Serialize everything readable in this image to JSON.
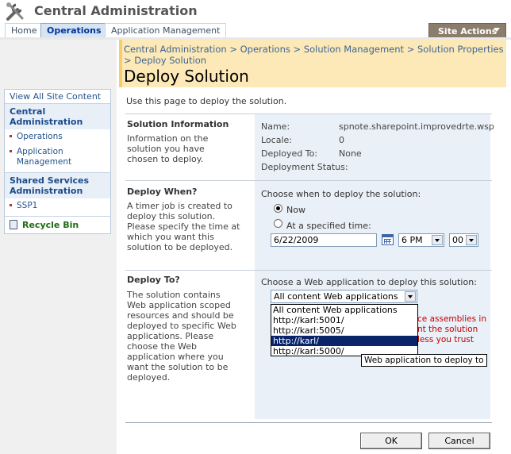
{
  "header": {
    "app_title": "Central Administration",
    "tabs": [
      "Home",
      "Operations",
      "Application Management"
    ],
    "selected_tab": "Operations",
    "site_actions": "Site Actions"
  },
  "leftnav": {
    "view_all": "View All Site Content",
    "groups": [
      {
        "title": "Central Administration",
        "items": [
          "Operations",
          "Application Management"
        ]
      },
      {
        "title": "Shared Services Administration",
        "items": [
          "SSP1"
        ]
      }
    ],
    "recycle_bin": "Recycle Bin"
  },
  "breadcrumb": "Central Administration > Operations > Solution Management > Solution Properties > Deploy Solution",
  "page_title": "Deploy Solution",
  "intro": "Use this page to deploy the solution.",
  "solution_info": {
    "title": "Solution Information",
    "description": "Information on the solution you have chosen to deploy.",
    "fields": [
      {
        "label": "Name:",
        "value": "spnote.sharepoint.improvedrte.wsp"
      },
      {
        "label": "Locale:",
        "value": "0"
      },
      {
        "label": "Deployed To:",
        "value": "None"
      },
      {
        "label": "Deployment Status:",
        "value": ""
      }
    ]
  },
  "deploy_when": {
    "title": "Deploy When?",
    "description": "A timer job is created to deploy this solution. Please specify the time at which you want this solution to be deployed.",
    "prompt": "Choose when to deploy the solution:",
    "option_now": "Now",
    "option_specified": "At a specified time:",
    "selected": "Now",
    "date": "6/22/2009",
    "hour": "6 PM",
    "minute": "00"
  },
  "deploy_to": {
    "title": "Deploy To?",
    "description": "The solution contains Web application scoped resources and should be deployed to specific Web applications. Please choose the Web application where you want the solution to be deployed.",
    "prompt": "Choose a Web application to deploy this solution:",
    "selected_value": "All content Web applications",
    "options": [
      "All content Web applications",
      "http://karl:5001/",
      "http://karl:5005/",
      "http://karl/",
      "http://karl:5000/"
    ],
    "highlighted_option": "http://karl/",
    "warning_partial": "ce assemblies in nt the solution less you trust",
    "tooltip": "Web application to deploy to"
  },
  "buttons": {
    "ok": "OK",
    "cancel": "Cancel"
  },
  "colors": {
    "title_band": "#fce9b7",
    "site_actions": "#8b7d6b",
    "link": "#26548b",
    "warning": "#c00000",
    "selection": "#0a246a"
  }
}
